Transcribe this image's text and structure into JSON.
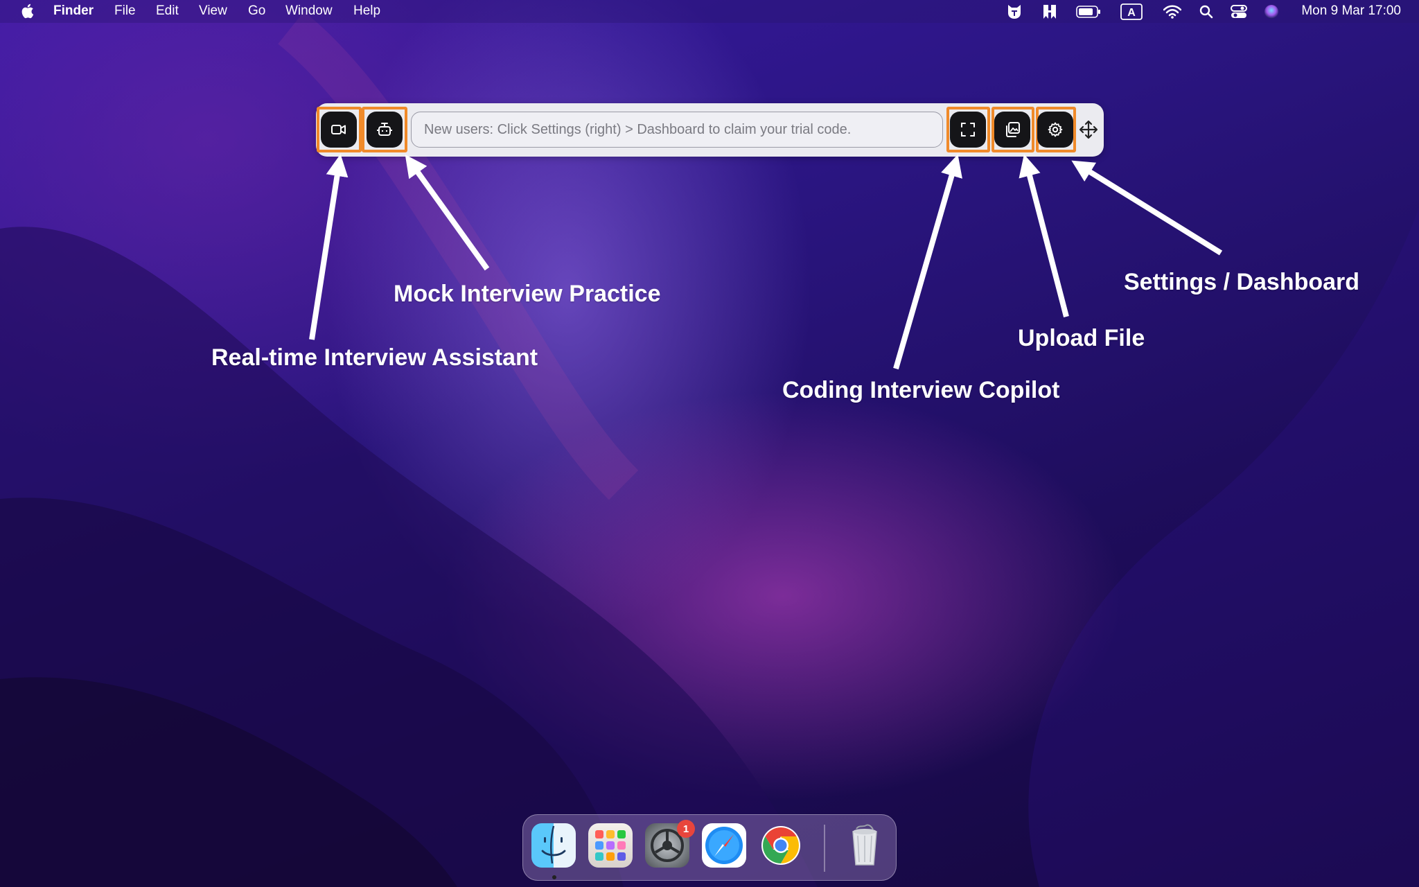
{
  "menubar": {
    "app_name": "Finder",
    "items": [
      "File",
      "Edit",
      "View",
      "Go",
      "Window",
      "Help"
    ],
    "status_icons": [
      "cat-face-icon",
      "bookmark-app-icon",
      "battery-icon",
      "input-source-icon",
      "wifi-icon",
      "spotlight-search-icon",
      "control-center-icon",
      "siri-icon"
    ],
    "input_source_letter": "A",
    "clock": "Mon 9 Mar  17:00"
  },
  "toolbar": {
    "input_placeholder": "New users: Click Settings (right) > Dashboard to claim your trial code.",
    "buttons": [
      "video-camera-icon",
      "robot-icon",
      "screenshot-frame-icon",
      "upload-image-icon",
      "gear-icon",
      "move-arrows-icon"
    ],
    "highlight_color": "#f08a2a"
  },
  "annotations": {
    "realtime": "Real-time Interview Assistant",
    "mock": "Mock Interview Practice",
    "coding": "Coding Interview Copilot",
    "upload": "Upload File",
    "settings": "Settings / Dashboard"
  },
  "dock": {
    "apps": [
      "Finder",
      "Launchpad",
      "System Settings",
      "Safari",
      "Google Chrome",
      "Trash"
    ],
    "badge_count": "1"
  }
}
